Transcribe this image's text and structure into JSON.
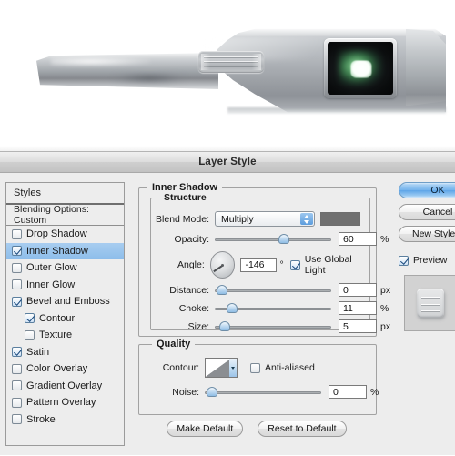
{
  "render": {
    "alt_description": "Brushed-metal wedge-shaped device render with embossed grille and glowing green-white screen",
    "screen_glow_color": "#b9ffc4",
    "metal_light": "#e9eaec",
    "metal_dark": "#86898e"
  },
  "dialog": {
    "title": "Layer Style",
    "sidebar": {
      "header": "Styles",
      "subheader": "Blending Options: Custom",
      "items": [
        {
          "label": "Drop Shadow",
          "checked": false,
          "selected": false,
          "indent": false
        },
        {
          "label": "Inner Shadow",
          "checked": true,
          "selected": true,
          "indent": false
        },
        {
          "label": "Outer Glow",
          "checked": false,
          "selected": false,
          "indent": false
        },
        {
          "label": "Inner Glow",
          "checked": false,
          "selected": false,
          "indent": false
        },
        {
          "label": "Bevel and Emboss",
          "checked": true,
          "selected": false,
          "indent": false
        },
        {
          "label": "Contour",
          "checked": true,
          "selected": false,
          "indent": true
        },
        {
          "label": "Texture",
          "checked": false,
          "selected": false,
          "indent": true
        },
        {
          "label": "Satin",
          "checked": true,
          "selected": false,
          "indent": false
        },
        {
          "label": "Color Overlay",
          "checked": false,
          "selected": false,
          "indent": false
        },
        {
          "label": "Gradient Overlay",
          "checked": false,
          "selected": false,
          "indent": false
        },
        {
          "label": "Pattern Overlay",
          "checked": false,
          "selected": false,
          "indent": false
        },
        {
          "label": "Stroke",
          "checked": false,
          "selected": false,
          "indent": false
        }
      ]
    },
    "panel": {
      "group_title": "Inner Shadow",
      "structure": {
        "legend": "Structure",
        "blend_mode_label": "Blend Mode:",
        "blend_mode_value": "Multiply",
        "blend_color": "#707070",
        "opacity_label": "Opacity:",
        "opacity_value": "60",
        "opacity_unit": "%",
        "opacity_percent": 60,
        "angle_label": "Angle:",
        "angle_value": "-146",
        "angle_unit": "°",
        "angle_degrees": -146,
        "use_global_light_label": "Use Global Light",
        "use_global_light_checked": true,
        "distance_label": "Distance:",
        "distance_value": "0",
        "distance_unit": "px",
        "distance_percent": 2,
        "choke_label": "Choke:",
        "choke_value": "11",
        "choke_unit": "%",
        "choke_percent": 11,
        "size_label": "Size:",
        "size_value": "5",
        "size_unit": "px",
        "size_percent": 4
      },
      "quality": {
        "legend": "Quality",
        "contour_label": "Contour:",
        "anti_aliased_label": "Anti-aliased",
        "anti_aliased_checked": false,
        "noise_label": "Noise:",
        "noise_value": "0",
        "noise_unit": "%",
        "noise_percent": 2
      },
      "make_default_label": "Make Default",
      "reset_to_default_label": "Reset to Default"
    },
    "buttons": {
      "ok": "OK",
      "cancel": "Cancel",
      "new_style": "New Style...",
      "preview_label": "Preview",
      "preview_checked": true
    }
  }
}
